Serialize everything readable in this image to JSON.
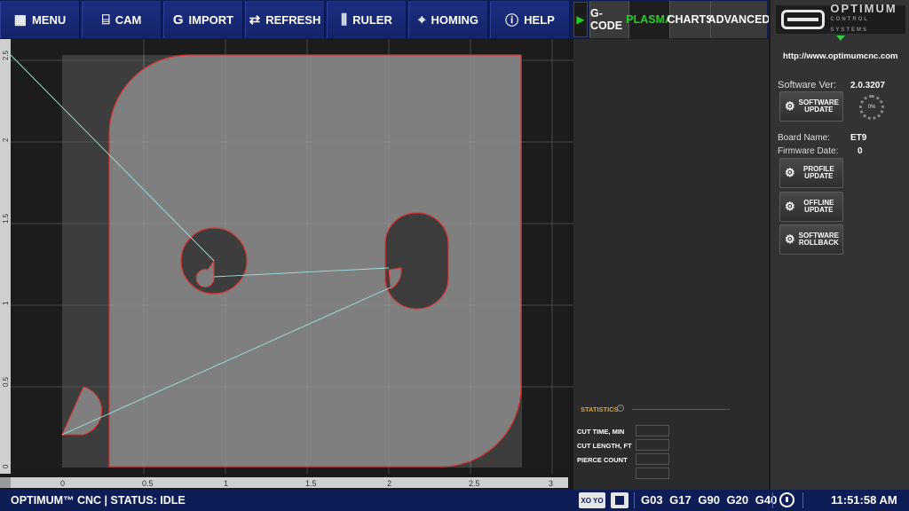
{
  "toolbar": {
    "buttons": [
      {
        "label": "MENU",
        "icon": "grid-icon"
      },
      {
        "label": "CAM",
        "icon": "cam-icon"
      },
      {
        "label": "IMPORT",
        "icon": "import-icon"
      },
      {
        "label": "REFRESH",
        "icon": "refresh-icon"
      },
      {
        "label": "RULER",
        "icon": "ruler-icon"
      },
      {
        "label": "HOMING",
        "icon": "crosshair-icon"
      },
      {
        "label": "HELP",
        "icon": "help-icon"
      }
    ],
    "tabs": [
      {
        "label": "G-CODE",
        "active": false
      },
      {
        "label": "PLASMA",
        "active": true
      },
      {
        "label": "CHARTS",
        "active": false
      },
      {
        "label": "ADVANCED",
        "active": false
      }
    ]
  },
  "logo": {
    "text": "OPTIMUM",
    "subtext": "CONTROL SYSTEMS"
  },
  "info": {
    "url": "http://www.optimumcnc.com",
    "software_ver_label": "Software Ver:",
    "software_ver": "2.0.3207",
    "board_name_label": "Board Name:",
    "board_name": "ET9",
    "firmware_date_label": "Firmware Date:",
    "firmware_date": "0",
    "progress_label": "0%",
    "buttons": {
      "software_update": "SOFTWARE\nUPDATE",
      "profile_update": "PROFILE\nUPDATE",
      "offline_update": "OFFLINE\nUPDATE",
      "software_rollback": "SOFTWARE\nROLLBACK"
    }
  },
  "statistics": {
    "title": "STATISTICS",
    "info_icon": "info-icon",
    "rows": [
      {
        "label": "CUT TIME, MIN",
        "value": ""
      },
      {
        "label": "CUT LENGTH, FT",
        "value": ""
      },
      {
        "label": "PIERCE COUNT",
        "value": ""
      },
      {
        "label": "",
        "value": ""
      }
    ]
  },
  "viewport": {
    "x_ticks": [
      "0",
      "0.5",
      "1",
      "1.5",
      "2",
      "2.5",
      "3"
    ],
    "y_ticks": [
      "2.5",
      "2",
      "1.5",
      "1",
      "0.5",
      "0"
    ],
    "colors": {
      "part_fill": "#7f7f7f",
      "cut_path": "#d33",
      "traverse": "#9fe0e0",
      "bed": "#3d3d3d"
    }
  },
  "status_bar": {
    "status_text": "OPTIMUM™ CNC | STATUS: IDLE",
    "xy_label": "XO YO",
    "gcodes": "G03 G17 G90 G20 G40",
    "time": "11:51:58 AM"
  }
}
